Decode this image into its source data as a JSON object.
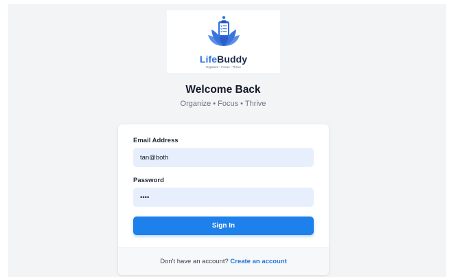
{
  "logo": {
    "brand_part1": "Life",
    "brand_part2": "Buddy",
    "tagline": "Organize • Focus • Thrive",
    "icon": "lotus-clipboard-icon"
  },
  "header": {
    "title": "Welcome Back",
    "subtitle": "Organize • Focus • Thrive"
  },
  "form": {
    "email_label": "Email Address",
    "email_value": "tan@both",
    "password_label": "Password",
    "password_value": "••••",
    "signin_label": "Sign In"
  },
  "footer": {
    "prompt": "Don't have an account?",
    "link": "Create an account"
  },
  "colors": {
    "primary": "#1e80ea",
    "input_bg": "#e8effc",
    "page_bg": "#f3f4f6",
    "brand_blue": "#2f6fe0",
    "brand_navy": "#1b2a4a"
  }
}
